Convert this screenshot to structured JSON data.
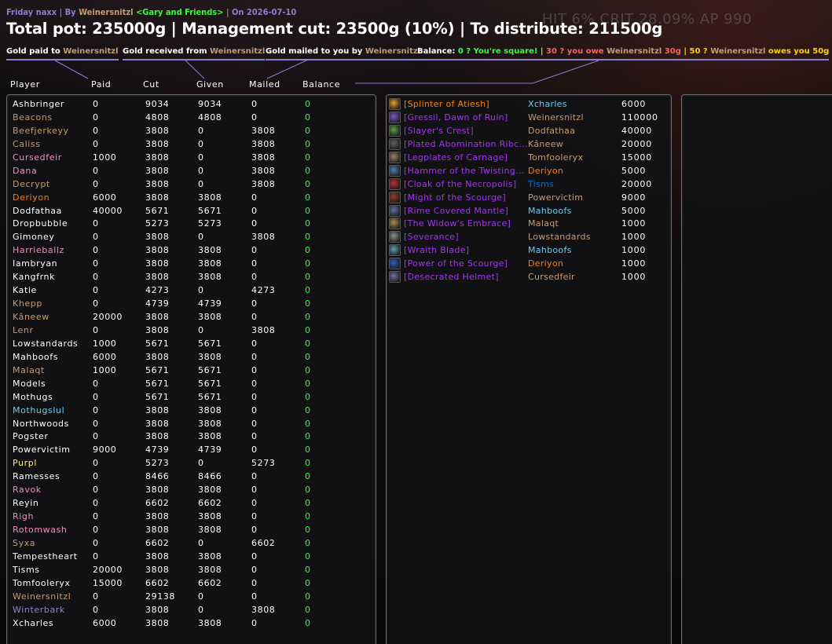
{
  "colors": {
    "header_line_1": "#8a7fd0",
    "balance_ok": "#33ff33",
    "item_epic": "#a335ee",
    "item_legendary": "#ff8000"
  },
  "hud": {
    "text": "HIT 6% CRIT 28.09%  AP 990"
  },
  "topline": {
    "event": "Friday naxx",
    "sep1": " | By ",
    "author": "Weinersnitzl",
    "guild": "<Gary and Friends>",
    "sep2": " | On ",
    "date": "2026-07-10"
  },
  "title": "Total pot: 235000g | Management cut: 23500g (10%) | To distribute: 211500g",
  "legend": {
    "paid": {
      "label": "Gold paid to ",
      "name": "Weinersnitzl"
    },
    "received": {
      "label": "Gold received from ",
      "name": "Weinersnitzl"
    },
    "mailed": {
      "label": "Gold mailed to you by ",
      "name": "Weinersnitzl"
    },
    "balance": {
      "label": "Balance:",
      "zero": "0 ? You're square!",
      "sep1": " | ",
      "owe_prefix": "30 ? you owe ",
      "owe_name": "Weinersnitzl",
      "owe_amount": " 30g",
      "sep2": " | ",
      "owes_prefix": "50 ? ",
      "owes_name": "Weinersnitzl",
      "owes_suffix": " owes you 50g"
    }
  },
  "columns": {
    "player": "Player",
    "paid": "Paid",
    "cut": "Cut",
    "given": "Given",
    "mailed": "Mailed",
    "balance": "Balance"
  },
  "players": [
    {
      "name": "Ashbringer",
      "color": "#ffffff",
      "paid": "0",
      "cut": "9034",
      "given": "9034",
      "mailed": "0",
      "balance": "0"
    },
    {
      "name": "Beacons",
      "color": "#c79c6e",
      "paid": "0",
      "cut": "4808",
      "given": "4808",
      "mailed": "0",
      "balance": "0"
    },
    {
      "name": "Beefjerkeyy",
      "color": "#c79c6e",
      "paid": "0",
      "cut": "3808",
      "given": "0",
      "mailed": "3808",
      "balance": "0"
    },
    {
      "name": "Caliss",
      "color": "#c79c6e",
      "paid": "0",
      "cut": "3808",
      "given": "0",
      "mailed": "3808",
      "balance": "0"
    },
    {
      "name": "Cursedfeir",
      "color": "#f58cba",
      "paid": "1000",
      "cut": "3808",
      "given": "0",
      "mailed": "3808",
      "balance": "0"
    },
    {
      "name": "Dana",
      "color": "#f58cba",
      "paid": "0",
      "cut": "3808",
      "given": "0",
      "mailed": "3808",
      "balance": "0"
    },
    {
      "name": "Decrypt",
      "color": "#c79c6e",
      "paid": "0",
      "cut": "3808",
      "given": "0",
      "mailed": "3808",
      "balance": "0"
    },
    {
      "name": "Deriyon",
      "color": "#ff7d0a",
      "paid": "6000",
      "cut": "3808",
      "given": "3808",
      "mailed": "0",
      "balance": "0"
    },
    {
      "name": "Dodfathaa",
      "color": "#ffffff",
      "paid": "40000",
      "cut": "5671",
      "given": "5671",
      "mailed": "0",
      "balance": "0"
    },
    {
      "name": "Dropbubble",
      "color": "#ffffff",
      "paid": "0",
      "cut": "5273",
      "given": "5273",
      "mailed": "0",
      "balance": "0"
    },
    {
      "name": "Gimoney",
      "color": "#ffffff",
      "paid": "0",
      "cut": "3808",
      "given": "0",
      "mailed": "3808",
      "balance": "0"
    },
    {
      "name": "Harrieballz",
      "color": "#f58cba",
      "paid": "0",
      "cut": "3808",
      "given": "3808",
      "mailed": "0",
      "balance": "0"
    },
    {
      "name": "Iambryan",
      "color": "#ffffff",
      "paid": "0",
      "cut": "3808",
      "given": "3808",
      "mailed": "0",
      "balance": "0"
    },
    {
      "name": "Kangfrnk",
      "color": "#ffffff",
      "paid": "0",
      "cut": "3808",
      "given": "3808",
      "mailed": "0",
      "balance": "0"
    },
    {
      "name": "Katie",
      "color": "#ffffff",
      "paid": "0",
      "cut": "4273",
      "given": "0",
      "mailed": "4273",
      "balance": "0"
    },
    {
      "name": "Khepp",
      "color": "#c79c6e",
      "paid": "0",
      "cut": "4739",
      "given": "4739",
      "mailed": "0",
      "balance": "0"
    },
    {
      "name": "Kâneew",
      "color": "#c79c6e",
      "paid": "20000",
      "cut": "3808",
      "given": "3808",
      "mailed": "0",
      "balance": "0"
    },
    {
      "name": "Lenr",
      "color": "#c79c6e",
      "paid": "0",
      "cut": "3808",
      "given": "0",
      "mailed": "3808",
      "balance": "0"
    },
    {
      "name": "Lowstandards",
      "color": "#ffffff",
      "paid": "1000",
      "cut": "5671",
      "given": "5671",
      "mailed": "0",
      "balance": "0"
    },
    {
      "name": "Mahboofs",
      "color": "#ffffff",
      "paid": "6000",
      "cut": "3808",
      "given": "3808",
      "mailed": "0",
      "balance": "0"
    },
    {
      "name": "Malaqt",
      "color": "#c79c6e",
      "paid": "1000",
      "cut": "5671",
      "given": "5671",
      "mailed": "0",
      "balance": "0"
    },
    {
      "name": "Models",
      "color": "#ffffff",
      "paid": "0",
      "cut": "5671",
      "given": "5671",
      "mailed": "0",
      "balance": "0"
    },
    {
      "name": "Mothugs",
      "color": "#ffffff",
      "paid": "0",
      "cut": "5671",
      "given": "5671",
      "mailed": "0",
      "balance": "0"
    },
    {
      "name": "Mothugslul",
      "color": "#69ccf0",
      "paid": "0",
      "cut": "3808",
      "given": "3808",
      "mailed": "0",
      "balance": "0"
    },
    {
      "name": "Northwoods",
      "color": "#ffffff",
      "paid": "0",
      "cut": "3808",
      "given": "3808",
      "mailed": "0",
      "balance": "0"
    },
    {
      "name": "Pogster",
      "color": "#ffffff",
      "paid": "0",
      "cut": "3808",
      "given": "3808",
      "mailed": "0",
      "balance": "0"
    },
    {
      "name": "Powervictim",
      "color": "#ffffff",
      "paid": "9000",
      "cut": "4739",
      "given": "4739",
      "mailed": "0",
      "balance": "0"
    },
    {
      "name": "Purpl",
      "color": "#fff569",
      "paid": "0",
      "cut": "5273",
      "given": "0",
      "mailed": "5273",
      "balance": "0"
    },
    {
      "name": "Ramesses",
      "color": "#ffffff",
      "paid": "0",
      "cut": "8466",
      "given": "8466",
      "mailed": "0",
      "balance": "0"
    },
    {
      "name": "Ravok",
      "color": "#f58cba",
      "paid": "0",
      "cut": "3808",
      "given": "3808",
      "mailed": "0",
      "balance": "0"
    },
    {
      "name": "Reyin",
      "color": "#ffffff",
      "paid": "0",
      "cut": "6602",
      "given": "6602",
      "mailed": "0",
      "balance": "0"
    },
    {
      "name": "Righ",
      "color": "#f58cba",
      "paid": "0",
      "cut": "3808",
      "given": "3808",
      "mailed": "0",
      "balance": "0"
    },
    {
      "name": "Rotomwash",
      "color": "#f58cba",
      "paid": "0",
      "cut": "3808",
      "given": "3808",
      "mailed": "0",
      "balance": "0"
    },
    {
      "name": "Syxa",
      "color": "#c79c6e",
      "paid": "0",
      "cut": "6602",
      "given": "0",
      "mailed": "6602",
      "balance": "0"
    },
    {
      "name": "Tempestheart",
      "color": "#ffffff",
      "paid": "0",
      "cut": "3808",
      "given": "3808",
      "mailed": "0",
      "balance": "0"
    },
    {
      "name": "Tisms",
      "color": "#ffffff",
      "paid": "20000",
      "cut": "3808",
      "given": "3808",
      "mailed": "0",
      "balance": "0"
    },
    {
      "name": "Tomfooleryx",
      "color": "#ffffff",
      "paid": "15000",
      "cut": "6602",
      "given": "6602",
      "mailed": "0",
      "balance": "0"
    },
    {
      "name": "Weinersnitzl",
      "color": "#c79c6e",
      "paid": "0",
      "cut": "29138",
      "given": "0",
      "mailed": "0",
      "balance": "0"
    },
    {
      "name": "Winterbark",
      "color": "#9482c9",
      "paid": "0",
      "cut": "3808",
      "given": "0",
      "mailed": "3808",
      "balance": "0"
    },
    {
      "name": "Xcharles",
      "color": "#ffffff",
      "paid": "6000",
      "cut": "3808",
      "given": "3808",
      "mailed": "0",
      "balance": "0"
    }
  ],
  "loot": [
    {
      "item": "[Splinter of Atiesh]",
      "quality": "legendary",
      "icon_color": "#e8a030",
      "winner": "Xcharles",
      "winner_color": "#69ccf0",
      "amount": "6000"
    },
    {
      "item": "[Gressil, Dawn of Ruin]",
      "quality": "epic",
      "icon_color": "#7a5ac8",
      "winner": "Weinersnitzl",
      "winner_color": "#c79c6e",
      "amount": "110000"
    },
    {
      "item": "[Slayer's Crest]",
      "quality": "epic",
      "icon_color": "#5aa040",
      "winner": "Dodfathaa",
      "winner_color": "#c79c6e",
      "amount": "40000"
    },
    {
      "item": "[Plated Abomination Ribc...",
      "quality": "epic",
      "icon_color": "#606060",
      "winner": "Kâneew",
      "winner_color": "#c79c6e",
      "amount": "20000"
    },
    {
      "item": "[Legplates of Carnage]",
      "quality": "epic",
      "icon_color": "#9a8a60",
      "winner": "Tomfooleryx",
      "winner_color": "#c79c6e",
      "amount": "15000"
    },
    {
      "item": "[Hammer of the Twisting...",
      "quality": "epic",
      "icon_color": "#5080b0",
      "winner": "Deriyon",
      "winner_color": "#ff7d0a",
      "amount": "5000"
    },
    {
      "item": "[Cloak of the Necropolis]",
      "quality": "epic",
      "icon_color": "#c03030",
      "winner": "Tisms",
      "winner_color": "#0070de",
      "amount": "20000"
    },
    {
      "item": "[Might of the Scourge]",
      "quality": "epic",
      "icon_color": "#904030",
      "winner": "Powervictim",
      "winner_color": "#c79c6e",
      "amount": "9000"
    },
    {
      "item": "[Rime Covered Mantle]",
      "quality": "epic",
      "icon_color": "#6070a0",
      "winner": "Mahboofs",
      "winner_color": "#69ccf0",
      "amount": "5000"
    },
    {
      "item": "[The Widow's Embrace]",
      "quality": "epic",
      "icon_color": "#b09050",
      "winner": "Malaqt",
      "winner_color": "#c79c6e",
      "amount": "1000"
    },
    {
      "item": "[Severance]",
      "quality": "epic",
      "icon_color": "#909090",
      "winner": "Lowstandards",
      "winner_color": "#c79c6e",
      "amount": "1000"
    },
    {
      "item": "[Wraith Blade]",
      "quality": "epic",
      "icon_color": "#60a0b0",
      "winner": "Mahboofs",
      "winner_color": "#69ccf0",
      "amount": "1000"
    },
    {
      "item": "[Power of the Scourge]",
      "quality": "epic",
      "icon_color": "#3060c0",
      "winner": "Deriyon",
      "winner_color": "#ff7d0a",
      "amount": "1000"
    },
    {
      "item": "[Desecrated Helmet]",
      "quality": "epic",
      "icon_color": "#7070a0",
      "winner": "Cursedfeir",
      "winner_color": "#c79c6e",
      "amount": "1000"
    }
  ]
}
